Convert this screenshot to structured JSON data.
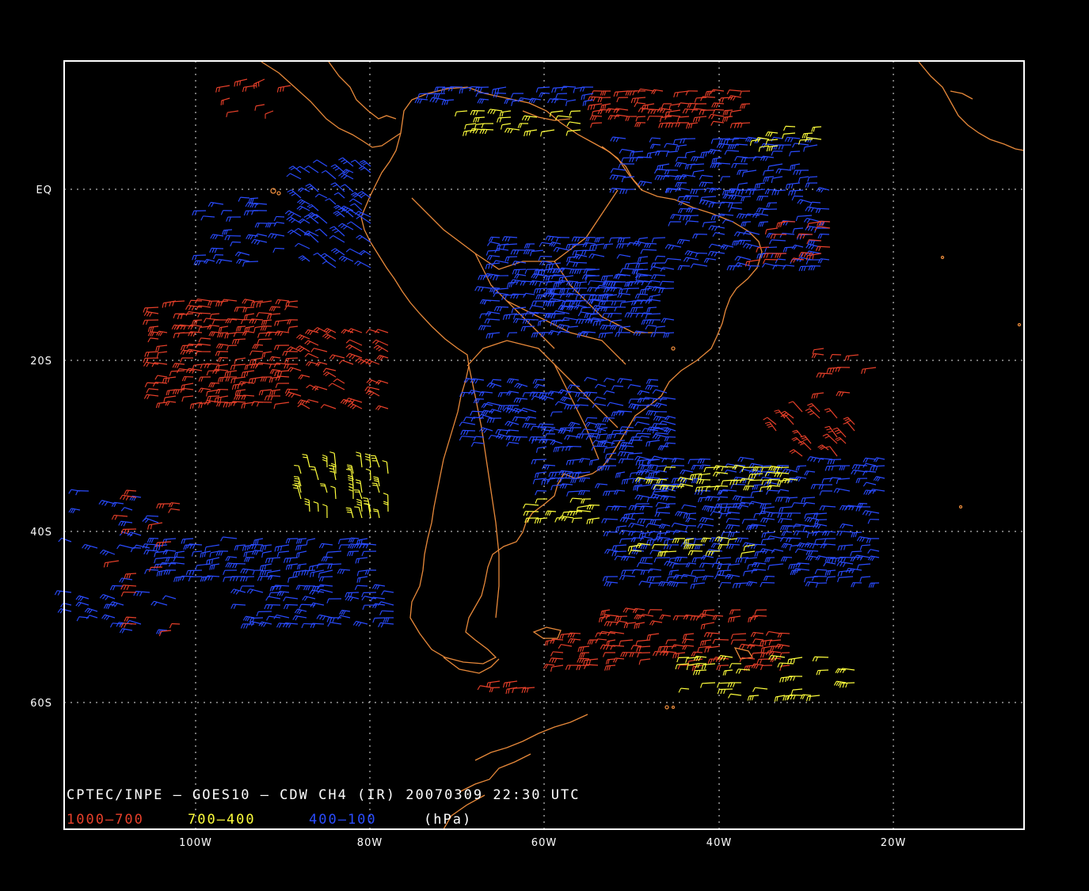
{
  "title": "CPTEC/INPE — GOES10 — CDW CH4 (IR) 20070309 22:30 UTC",
  "legend": {
    "low": "1000—700",
    "mid": "700—400",
    "high": "400—100",
    "unit": "(hPa)"
  },
  "axes": {
    "x_ticks": [
      "100W",
      "80W",
      "60W",
      "40W",
      "20W"
    ],
    "y_ticks": [
      "EQ",
      "20S",
      "40S",
      "60S"
    ]
  },
  "colors": {
    "background": "#000000",
    "frame": "#ffffff",
    "coastline": "#e8893a",
    "low_level": "#e8402a",
    "mid_level": "#ffff3c",
    "high_level": "#2a4cff",
    "grid": "#ffffff"
  },
  "map_extent": {
    "lon": [
      -115,
      -5
    ],
    "lat": [
      15,
      -75
    ]
  }
}
